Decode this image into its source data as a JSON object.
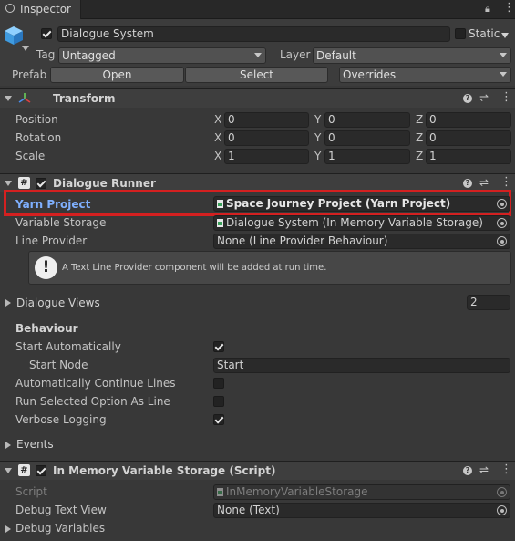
{
  "tab": {
    "title": "Inspector"
  },
  "gameobject": {
    "name": "Dialogue System",
    "static_label": "Static",
    "tag_label": "Tag",
    "tag_value": "Untagged",
    "layer_label": "Layer",
    "layer_value": "Default",
    "prefab_label": "Prefab",
    "open_label": "Open",
    "select_label": "Select",
    "overrides_label": "Overrides"
  },
  "transform": {
    "title": "Transform",
    "rows": [
      {
        "label": "Position",
        "x": "0",
        "y": "0",
        "z": "0"
      },
      {
        "label": "Rotation",
        "x": "0",
        "y": "0",
        "z": "0"
      },
      {
        "label": "Scale",
        "x": "1",
        "y": "1",
        "z": "1"
      }
    ],
    "axis": {
      "x": "X",
      "y": "Y",
      "z": "Z"
    }
  },
  "runner": {
    "title": "Dialogue Runner",
    "yarn_project_label": "Yarn Project",
    "yarn_project_value": "Space Journey Project (Yarn Project)",
    "variable_storage_label": "Variable Storage",
    "variable_storage_value": "Dialogue System (In Memory Variable Storage)",
    "line_provider_label": "Line Provider",
    "line_provider_value": "None (Line Provider Behaviour)",
    "info_text": "A Text Line Provider component will be added at run time.",
    "dialogue_views_label": "Dialogue Views",
    "dialogue_views_count": "2",
    "behaviour_label": "Behaviour",
    "start_auto_label": "Start Automatically",
    "start_node_label": "Start Node",
    "start_node_value": "Start",
    "auto_continue_label": "Automatically Continue Lines",
    "run_selected_label": "Run Selected Option As Line",
    "verbose_label": "Verbose Logging",
    "events_label": "Events",
    "start_auto": true,
    "auto_continue": false,
    "run_selected": false,
    "verbose": true
  },
  "storage": {
    "title": "In Memory Variable Storage (Script)",
    "script_label": "Script",
    "script_value": "InMemoryVariableStorage",
    "debug_text_label": "Debug Text View",
    "debug_text_value": "None (Text)",
    "debug_vars_label": "Debug Variables"
  },
  "colors": {
    "highlight": "#d42020",
    "accent_label": "#7fb0ff"
  }
}
